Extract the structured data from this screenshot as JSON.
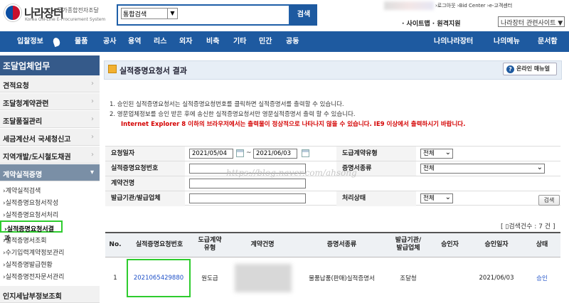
{
  "header": {
    "logo_title": "나라장터",
    "logo_subtitle": "국가종합전자조달",
    "logo_eng": "Korea ON-Line E-Procurement System",
    "search_scope": "통합검색",
    "search_button": "검색",
    "top_links": "›로그아웃  ›Bid Center  ›e-고객센터",
    "sitemap": "· 사이트맵 · 원격지원",
    "related_site": "나라장터 관련사이트"
  },
  "nav": {
    "items": [
      "입찰정보",
      "물품",
      "공사",
      "용역",
      "리스",
      "외자",
      "비축",
      "기타",
      "민간",
      "공동"
    ],
    "right_items": [
      "나의나라장터",
      "나의메뉴",
      "문서함"
    ]
  },
  "sidebar": {
    "title": "조달업체업무",
    "menus": [
      "견적요청",
      "조달청계약관련",
      "조달품질관리",
      "세금계산서 국세청신고",
      "지역개발/도시철도채권",
      "계약실적증명"
    ],
    "subitems": [
      "›계약실적검색",
      "›실적증명요청서작성",
      "›실적증명요청서처리",
      "›실적증명요청서결과",
      "›실적증명서조회",
      "›수기입력계약정보관리",
      "›실적증명발급현황",
      "›실적증명전자문서관리"
    ],
    "bottom_menu": "인지세납부정보조회"
  },
  "main": {
    "title": "실적증명요청서 결과",
    "manual_button": "온라인 매뉴얼",
    "notes": [
      "1. 승인된 실적증명요청서는 실적증명요청번호를 클릭하면 실적증명서를 출력할 수 있습니다.",
      "2. 영문업체정보를 승인 받은 후에 송신한 실적증명요청서만 영문실적증명서 출력 할 수 있습니다."
    ],
    "warning": "Internet Explorer 8 이하의 브라우저에서는 출력물이 정상적으로 나타나지 않을 수 있습니다. IE9 이상에서 출력하시기 바랍니다."
  },
  "form": {
    "request_date_label": "요청일자",
    "date_from": "2021/05/04",
    "date_to": "2021/06/03",
    "tilde": "~",
    "contract_type_label": "도급계약유형",
    "contract_type_value": "전체",
    "request_no_label": "실적증명요청번호",
    "request_no_value": "",
    "cert_type_label": "증명서종류",
    "cert_type_value": "전체",
    "contract_name_label": "계약건명",
    "contract_name_value": "",
    "issuer_label": "발급기관/발급업체",
    "issuer_value": "",
    "status_label": "처리상태",
    "status_value": "전체",
    "search_button": "검색",
    "watermark": "https://blog.naver.com/ahsong"
  },
  "results": {
    "count_text": "검색건수 : 7 건",
    "columns": [
      "No.",
      "실적증명요청번호",
      "도급계약\n유형",
      "계약건명",
      "증명서종류",
      "발급기관/\n발급업체",
      "승인자",
      "승인일자",
      "상태"
    ],
    "rows": [
      {
        "no": "1",
        "request_no": "2021065429880",
        "contract_type": "원도급",
        "contract_name": "",
        "cert_type": "물품납품(판매)실적증명서",
        "issuer": "조달청",
        "approver": "",
        "approval_date": "2021/06/03",
        "status": "승인"
      }
    ]
  },
  "colors": {
    "nav_blue": "#1e5aa0",
    "sidebar_title": "#355a8a",
    "highlight_green": "#2ecc2e",
    "warning_red": "#d40000",
    "link_blue": "#1e50c8"
  }
}
